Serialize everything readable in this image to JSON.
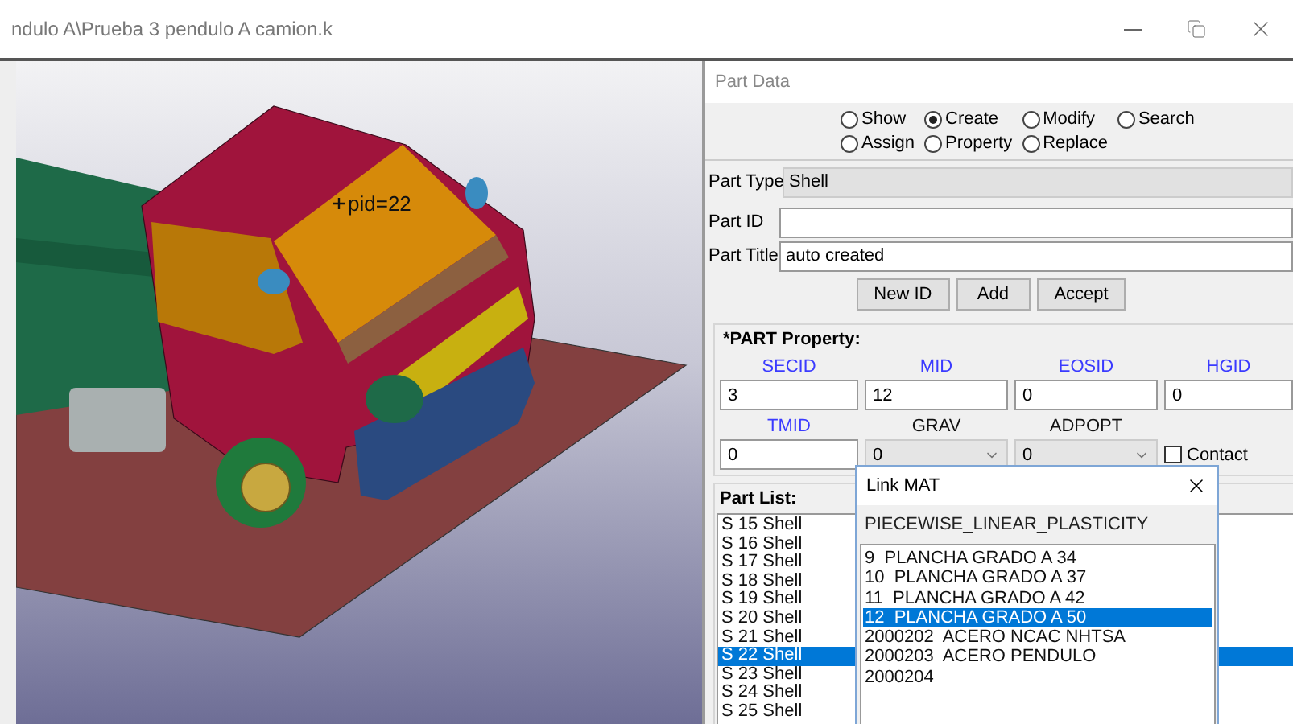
{
  "window": {
    "title": "ndulo A\\Prueba 3 pendulo A camion.k"
  },
  "viewport": {
    "label": "pid=22"
  },
  "part_data": {
    "title": "Part Data",
    "modes": [
      {
        "label": "Show",
        "selected": false
      },
      {
        "label": "Create",
        "selected": true
      },
      {
        "label": "Modify",
        "selected": false
      },
      {
        "label": "Search",
        "selected": false
      },
      {
        "label": "Assign",
        "selected": false
      },
      {
        "label": "Property",
        "selected": false
      },
      {
        "label": "Replace",
        "selected": false
      }
    ],
    "part_type": {
      "label": "Part Type",
      "value": "Shell"
    },
    "part_id": {
      "label": "Part ID"
    },
    "part_title": {
      "label": "Part Title",
      "value": "auto created"
    },
    "buttons": [
      "New ID",
      "Add",
      "Accept"
    ],
    "property": {
      "title": "*PART Property:",
      "fields": [
        {
          "kind": "input",
          "label": "SECID",
          "value": "3",
          "linked": true
        },
        {
          "kind": "input",
          "label": "MID",
          "value": "12",
          "linked": true
        },
        {
          "kind": "input",
          "label": "EOSID",
          "value": "0",
          "linked": true
        },
        {
          "kind": "input",
          "label": "HGID",
          "value": "0",
          "linked": true
        },
        {
          "kind": "input",
          "label": "TMID",
          "value": "0",
          "linked": true
        },
        {
          "kind": "select",
          "label": "GRAV",
          "value": "0",
          "linked": false
        },
        {
          "kind": "select",
          "label": "ADPOPT",
          "value": "0",
          "linked": false
        }
      ],
      "contact": {
        "label": "Contact",
        "checked": false
      }
    },
    "part_list": {
      "title": "Part List:",
      "items": [
        {
          "label": "S 15 Shell",
          "selected": false
        },
        {
          "label": "S 16 Shell",
          "selected": false
        },
        {
          "label": "S 17 Shell",
          "selected": false
        },
        {
          "label": "S 18 Shell",
          "selected": false
        },
        {
          "label": "S 19 Shell",
          "selected": false
        },
        {
          "label": "S 20 Shell",
          "selected": false
        },
        {
          "label": "S 21 Shell",
          "selected": false
        },
        {
          "label": "S 22 Shell",
          "selected": true
        },
        {
          "label": "S 23 Shell",
          "selected": false
        },
        {
          "label": "S 24 Shell",
          "selected": false
        },
        {
          "label": "S 25 Shell",
          "selected": false
        }
      ]
    }
  },
  "link_dialog": {
    "title": "Link MAT",
    "type": "PIECEWISE_LINEAR_PLASTICITY",
    "items": [
      {
        "label": "9  PLANCHA GRADO A 34",
        "selected": false
      },
      {
        "label": "10  PLANCHA GRADO A 37",
        "selected": false
      },
      {
        "label": "11  PLANCHA GRADO A 42",
        "selected": false
      },
      {
        "label": "12  PLANCHA GRADO A 50",
        "selected": true
      },
      {
        "label": "2000202  ACERO NCAC NHTSA",
        "selected": false
      },
      {
        "label": "2000203  ACERO PENDULO",
        "selected": false
      },
      {
        "label": "2000204",
        "selected": false
      }
    ]
  }
}
